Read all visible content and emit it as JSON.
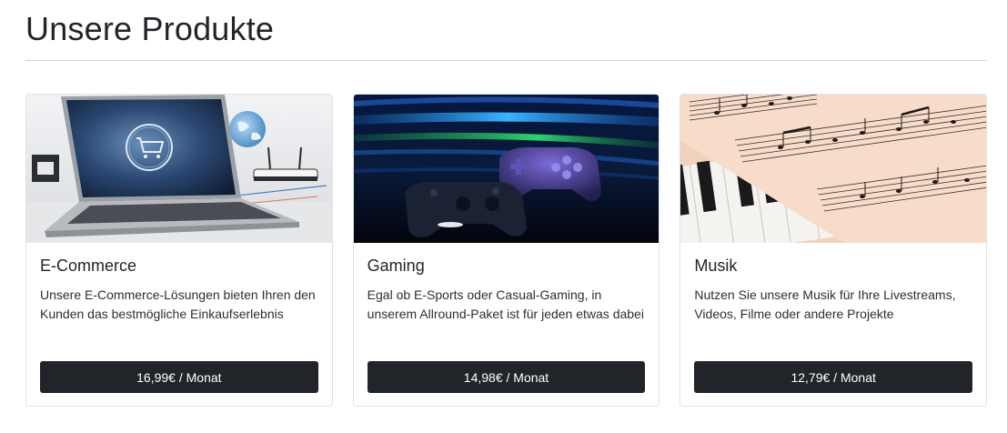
{
  "page": {
    "title": "Unsere Produkte"
  },
  "products": [
    {
      "name": "E-Commerce",
      "description": "Unsere E-Commerce-Lösungen bieten Ihren den Kunden das bestmögliche Einkaufserlebnis",
      "price": "16,99€ / Monat",
      "image_icon": "laptop-shopping-cart-image"
    },
    {
      "name": "Gaming",
      "description": "Egal ob E-Sports oder Casual-Gaming, in unserem Allround-Paket ist für jeden etwas dabei",
      "price": "14,98€ / Monat",
      "image_icon": "game-controllers-image"
    },
    {
      "name": "Musik",
      "description": "Nutzen Sie unsere Musik für Ihre Livestreams, Videos, Filme oder andere Projekte",
      "price": "12,79€ / Monat",
      "image_icon": "piano-sheet-music-image"
    }
  ],
  "colors": {
    "button_bg": "#212529",
    "button_text": "#ffffff",
    "text": "#212529"
  }
}
